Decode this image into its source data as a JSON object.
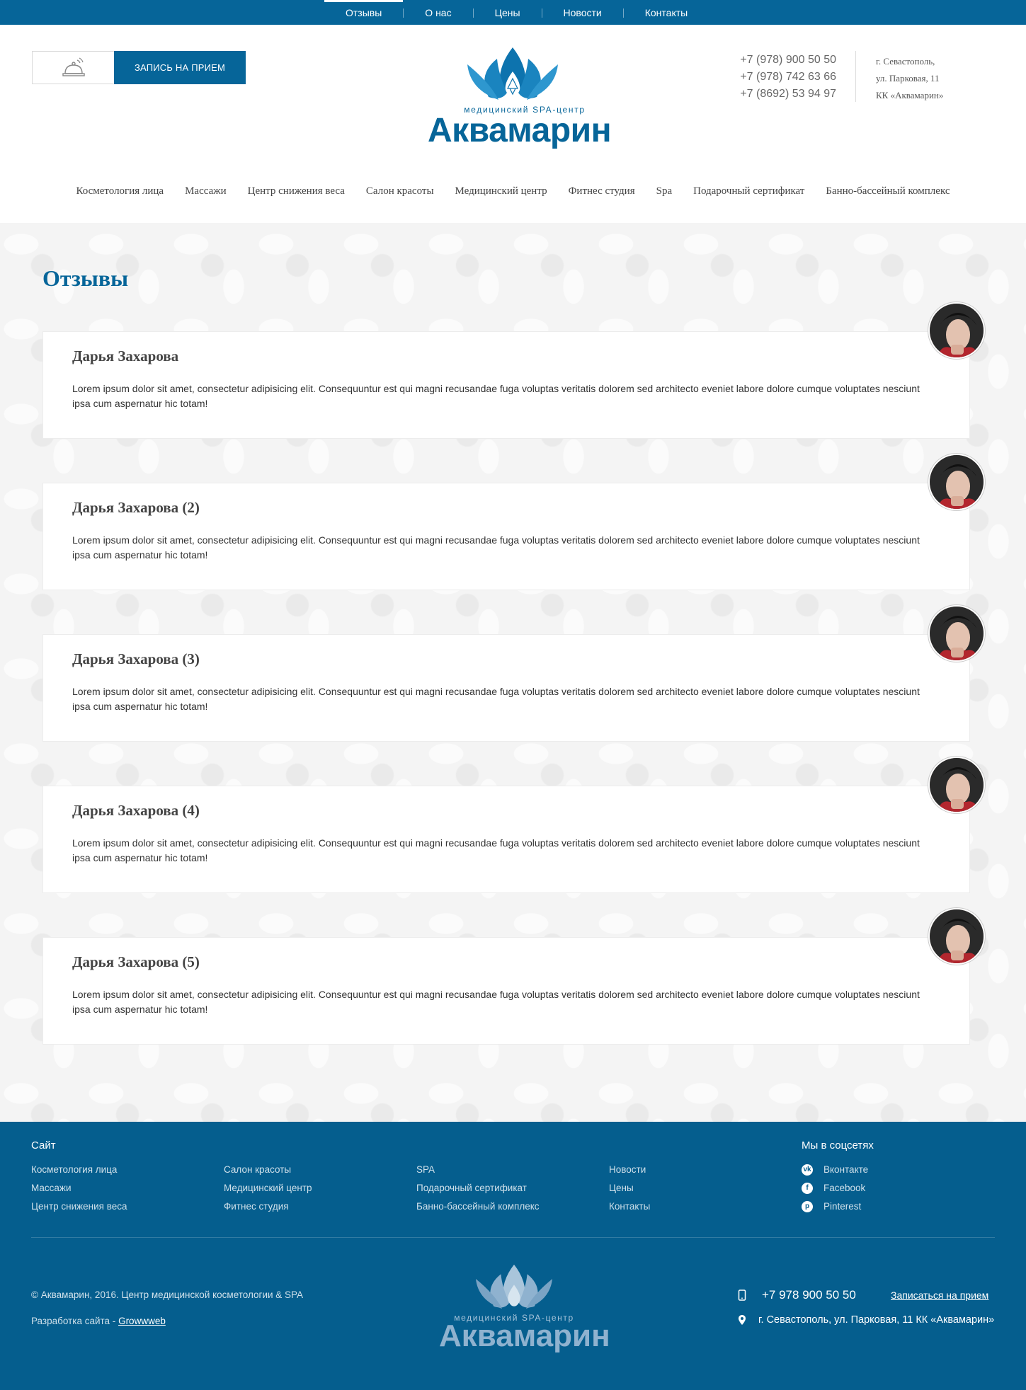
{
  "topnav": [
    "Отзывы",
    "О нас",
    "Цены",
    "Новости",
    "Контакты"
  ],
  "header": {
    "appointment_label": "ЗАПИСЬ НА ПРИЕМ",
    "logo_sub": "медицинский SPA-центр",
    "logo_main": "Аквамарин",
    "phones": [
      "+7 (978) 900 50 50",
      "+7 (978) 742 63 66",
      "+7 (8692) 53 94 97"
    ],
    "address": [
      "г. Севастополь,",
      "ул. Парковая, 11",
      "КК «Аквамарин»"
    ]
  },
  "mainnav": [
    "Косметология лица",
    "Массажи",
    "Центр снижения веса",
    "Салон красоты",
    "Медицинский центр",
    "Фитнес студия",
    "Spa",
    "Подарочный сертификат",
    "Банно-бассейный комплекс"
  ],
  "page": {
    "title": "Отзывы",
    "reviews": [
      {
        "name": "Дарья Захарова",
        "text": "Lorem ipsum dolor sit amet, consectetur adipisicing elit. Consequuntur est qui magni recusandae fuga voluptas veritatis dolorem sed architecto eveniet labore dolore cumque voluptates nesciunt ipsa cum aspernatur hic totam!"
      },
      {
        "name": "Дарья Захарова (2)",
        "text": "Lorem ipsum dolor sit amet, consectetur adipisicing elit. Consequuntur est qui magni recusandae fuga voluptas veritatis dolorem sed architecto eveniet labore dolore cumque voluptates nesciunt ipsa cum aspernatur hic totam!"
      },
      {
        "name": "Дарья Захарова (3)",
        "text": "Lorem ipsum dolor sit amet, consectetur adipisicing elit. Consequuntur est qui magni recusandae fuga voluptas veritatis dolorem sed architecto eveniet labore dolore cumque voluptates nesciunt ipsa cum aspernatur hic totam!"
      },
      {
        "name": "Дарья Захарова (4)",
        "text": "Lorem ipsum dolor sit amet, consectetur adipisicing elit. Consequuntur est qui magni recusandae fuga voluptas veritatis dolorem sed architecto eveniet labore dolore cumque voluptates nesciunt ipsa cum aspernatur hic totam!"
      },
      {
        "name": "Дарья Захарова (5)",
        "text": "Lorem ipsum dolor sit amet, consectetur adipisicing elit. Consequuntur est qui magni recusandae fuga voluptas veritatis dolorem sed architecto eveniet labore dolore cumque voluptates nesciunt ipsa cum aspernatur hic totam!"
      }
    ]
  },
  "footer": {
    "site_heading": "Сайт",
    "col1": [
      "Косметология лица",
      "Массажи",
      "Центр снижения веса"
    ],
    "col2": [
      "Салон красоты",
      "Медицинский центр",
      "Фитнес студия"
    ],
    "col3": [
      "SPA",
      "Подарочный сертификат",
      "Банно-бассейный комплекс"
    ],
    "col4": [
      "Новости",
      "Цены",
      "Контакты"
    ],
    "social_heading": "Мы в соцсетях",
    "social": [
      "Вконтакте",
      "Facebook",
      "Pinterest"
    ],
    "copyright": "© Аквамарин, 2016. Центр медицинской косметологии & SPA",
    "dev_prefix": "Разработка сайта -",
    "dev_link": "Growwweb",
    "logo_sub": "медицинский SPA-центр",
    "logo_main": "Аквамарин",
    "phone": "+7 978 900 50 50",
    "appointment_link": "Записаться на прием",
    "address": "г. Севастополь, ул. Парковая, 11 КК «Аквамарин»"
  },
  "colors": {
    "brand": "#066599",
    "footer_bg": "#055e8e"
  }
}
